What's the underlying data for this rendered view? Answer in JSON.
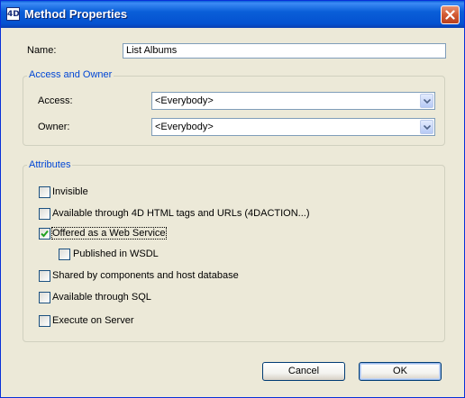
{
  "window": {
    "title": "Method Properties",
    "app_icon_text": "4D"
  },
  "name_field": {
    "label": "Name:",
    "value": "List Albums"
  },
  "access_group": {
    "title": "Access and Owner",
    "access_label": "Access:",
    "access_value": "<Everybody>",
    "owner_label": "Owner:",
    "owner_value": "<Everybody>"
  },
  "attributes_group": {
    "title": "Attributes",
    "items": [
      {
        "label": "Invisible",
        "checked": false
      },
      {
        "label": "Available through 4D HTML tags and URLs (4DACTION...)",
        "checked": false
      },
      {
        "label": "Offered as a Web Service",
        "checked": true
      },
      {
        "label": "Published in WSDL",
        "checked": false
      },
      {
        "label": "Shared by components and host database",
        "checked": false
      },
      {
        "label": "Available through SQL",
        "checked": false
      },
      {
        "label": "Execute on Server",
        "checked": false
      }
    ]
  },
  "buttons": {
    "cancel": "Cancel",
    "ok": "OK"
  },
  "icons": {
    "close": "close-icon",
    "dropdown": "chevron-down-icon",
    "check": "checkmark-icon"
  }
}
